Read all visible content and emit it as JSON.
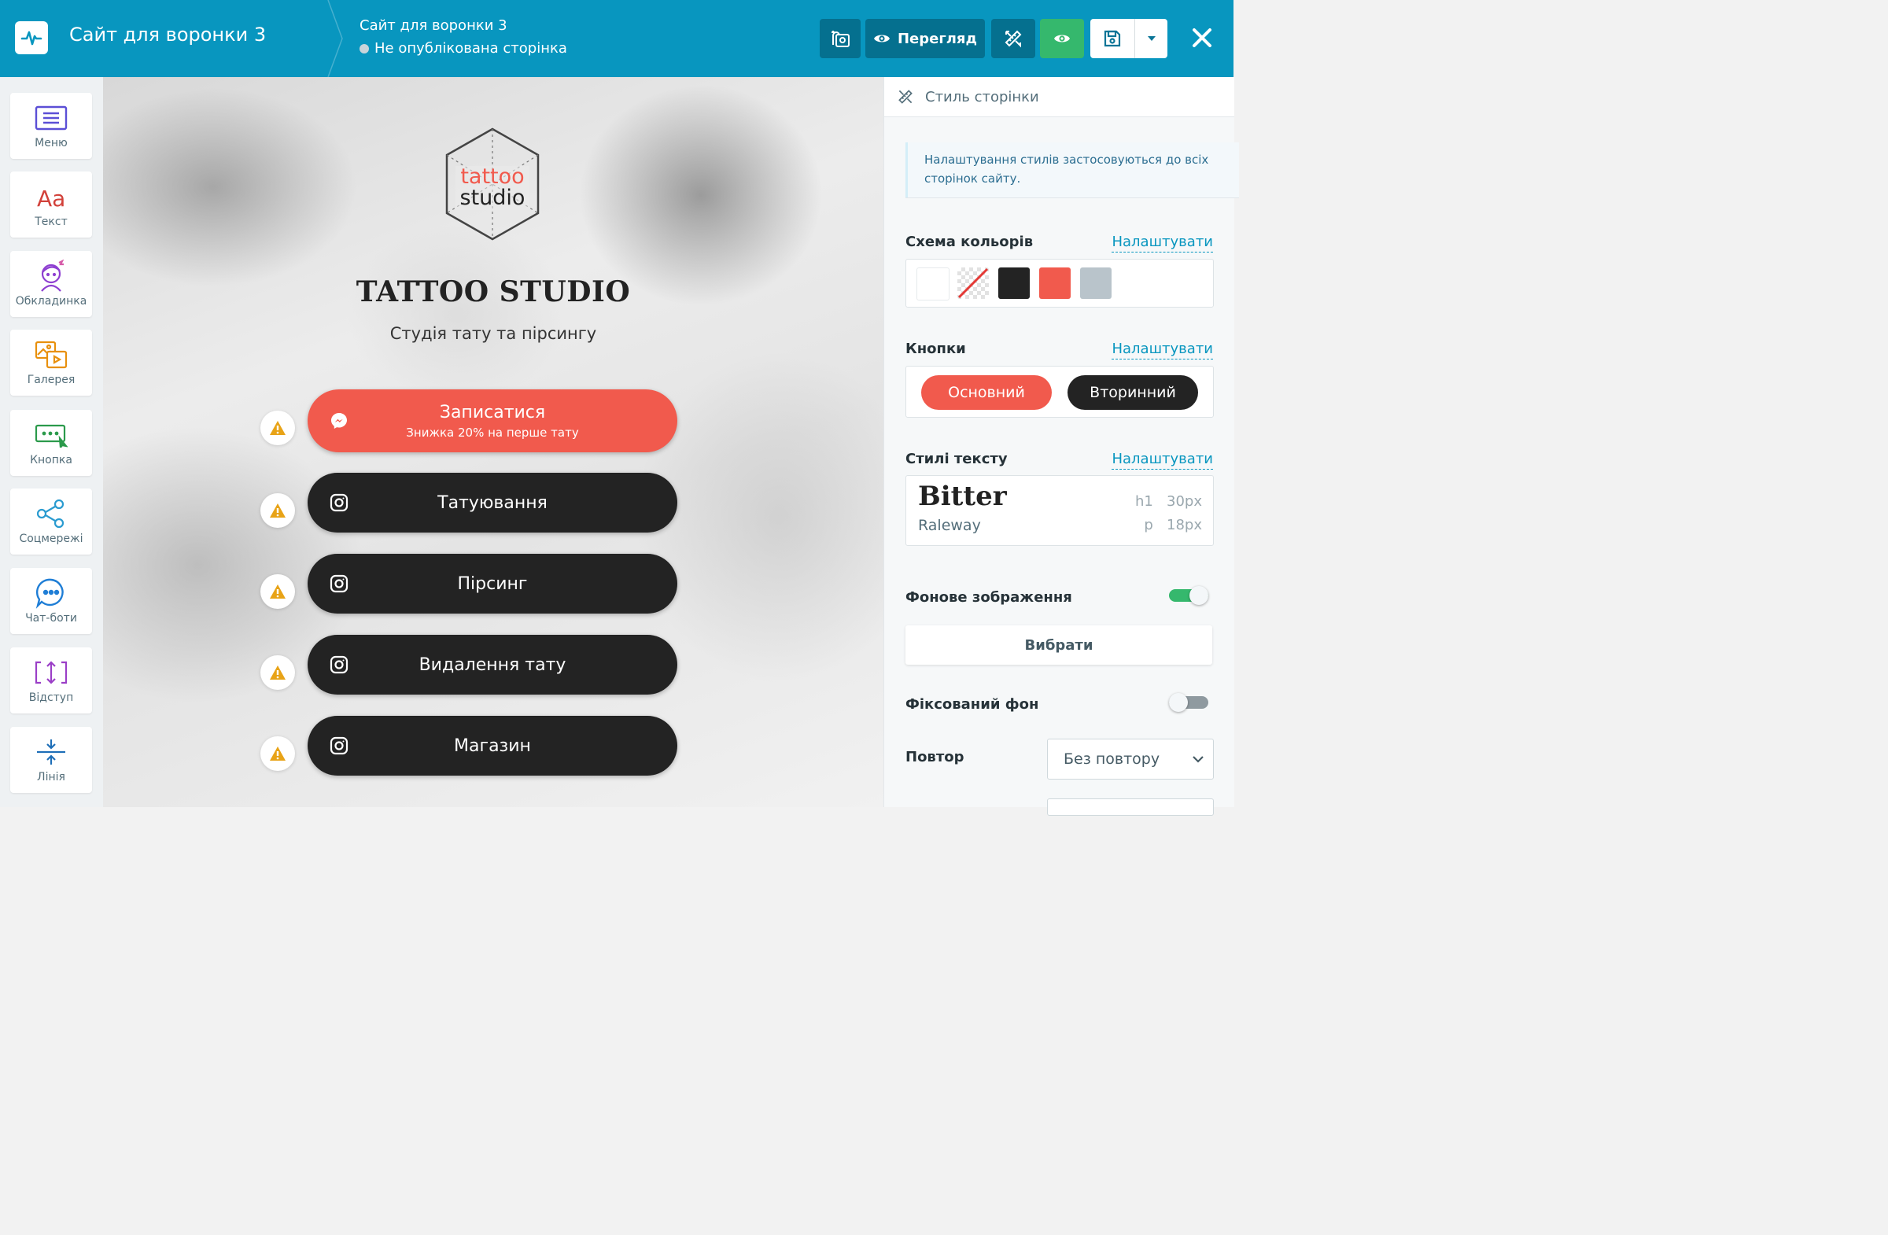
{
  "topbar": {
    "site_title": "Сайт для воронки 3",
    "page_title": "Сайт для воронки 3",
    "page_status": "Не опублікована сторінка",
    "preview_label": "Перегляд"
  },
  "blocks": [
    {
      "label": "Меню",
      "icon": "menu-block-icon"
    },
    {
      "label": "Текст",
      "icon": "text-block-icon"
    },
    {
      "label": "Обкладинка",
      "icon": "cover-block-icon"
    },
    {
      "label": "Галерея",
      "icon": "gallery-block-icon"
    },
    {
      "label": "Кнопка",
      "icon": "button-block-icon"
    },
    {
      "label": "Соцмережі",
      "icon": "social-block-icon"
    },
    {
      "label": "Чат-боти",
      "icon": "chatbot-block-icon"
    },
    {
      "label": "Відступ",
      "icon": "spacing-block-icon"
    },
    {
      "label": "Лінія",
      "icon": "line-block-icon"
    }
  ],
  "canvas": {
    "logo_line1": "tattoo",
    "logo_line2": "studio",
    "title": "TATTOO STUDIO",
    "subtitle": "Студія тату та пірсингу",
    "buttons": [
      {
        "label": "Записатися",
        "sublabel": "Знижка 20% на перше тату",
        "icon": "messenger-icon",
        "style": "primary"
      },
      {
        "label": "Татуювання",
        "icon": "instagram-icon",
        "style": "secondary"
      },
      {
        "label": "Пірсинг",
        "icon": "instagram-icon",
        "style": "secondary"
      },
      {
        "label": "Видалення тату",
        "icon": "instagram-icon",
        "style": "secondary"
      },
      {
        "label": "Магазин",
        "icon": "instagram-icon",
        "style": "secondary"
      }
    ]
  },
  "panel": {
    "header": "Стиль сторінки",
    "notice": "Налаштування стилів застосовуються до всіх сторінок сайту.",
    "color_scheme": {
      "label": "Схема кольорів",
      "link": "Налаштувати",
      "colors": [
        "#ffffff",
        "transparent",
        "#232323",
        "#f15a4d",
        "#b9c4cb"
      ]
    },
    "buttons": {
      "label": "Кнопки",
      "link": "Налаштувати",
      "primary": "Основний",
      "secondary": "Вторинний"
    },
    "text_styles": {
      "label": "Стилі тексту",
      "link": "Налаштувати",
      "heading_font": "Bitter",
      "body_font": "Raleway",
      "h1_tag": "h1",
      "h1_size": "30px",
      "p_tag": "p",
      "p_size": "18px"
    },
    "bg_image": {
      "label": "Фонове зображення",
      "enabled": true,
      "choose_label": "Вибрати"
    },
    "fixed_bg": {
      "label": "Фіксований фон",
      "enabled": false
    },
    "repeat": {
      "label": "Повтор",
      "value": "Без повтору"
    }
  },
  "colors": {
    "topbar": "#0896bf",
    "accent_green": "#35b86d",
    "primary_button": "#f15a4d",
    "secondary_button": "#232323"
  }
}
